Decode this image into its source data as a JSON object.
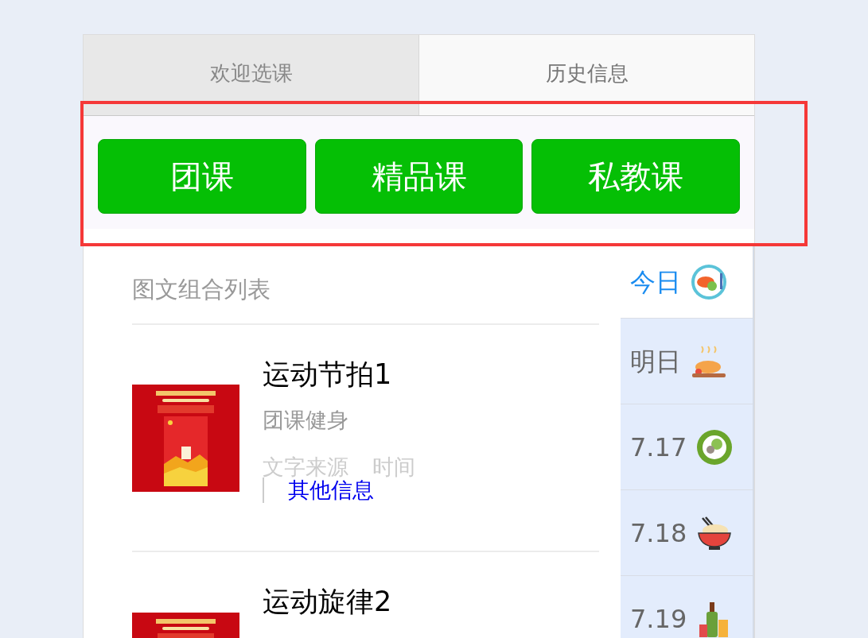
{
  "tabs": [
    {
      "label": "欢迎选课",
      "selected": false
    },
    {
      "label": "历史信息",
      "selected": true
    }
  ],
  "course_buttons": [
    "团课",
    "精品课",
    "私教课"
  ],
  "highlight_frame": {
    "kind": "annotation"
  },
  "list": {
    "title": "图文组合列表",
    "items": [
      {
        "title": "运动节拍1",
        "subtitle": "团课健身",
        "source": "文字来源",
        "time": "时间",
        "other": "其他信息"
      },
      {
        "title": "运动旋律2"
      }
    ]
  },
  "day_menu": [
    {
      "label": "今日",
      "selected": true
    },
    {
      "label": "明日",
      "selected": false
    },
    {
      "label": "7.17",
      "selected": false
    },
    {
      "label": "7.18",
      "selected": false
    },
    {
      "label": "7.19",
      "selected": false
    }
  ]
}
